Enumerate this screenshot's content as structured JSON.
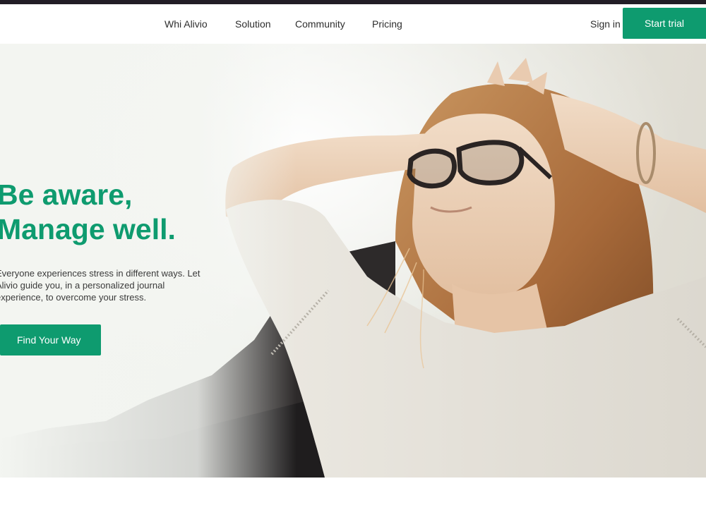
{
  "nav": {
    "links": [
      "Whi Alivio",
      "Solution",
      "Community",
      "Pricing"
    ],
    "sign_in": "Sign in",
    "start_trial": "Start trial"
  },
  "hero": {
    "title_line1": "Be aware,",
    "title_line2": "Manage well.",
    "description": "Everyone experiences stress in different ways. Let Alivio guide you, in a personalized journal experience, to overcome your stress.",
    "cta": "Find Your Way",
    "image_subject": "woman-with-glasses-relaxing-in-sunlight"
  },
  "colors": {
    "brand_green": "#0e9b6f",
    "top_bar": "#221d26",
    "text": "#2e2e2e"
  }
}
